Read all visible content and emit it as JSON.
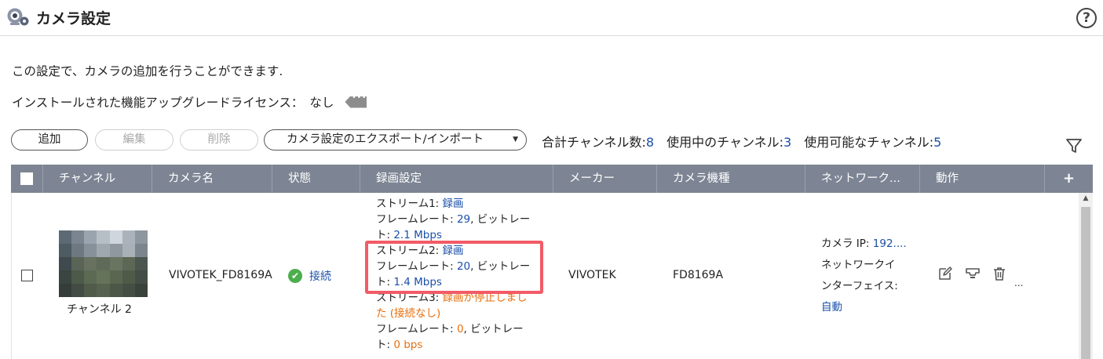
{
  "header": {
    "title": "カメラ設定",
    "help_glyph": "?",
    "app_icon": "camera-settings-icon"
  },
  "description": "この設定で、カメラの追加を行うことができます.",
  "license": {
    "label": "インストールされた機能アップグレードライセンス：",
    "value": "なし"
  },
  "toolbar": {
    "add_label": "追加",
    "edit_label": "編集",
    "delete_label": "削除",
    "export_import_label": "カメラ設定のエクスポート/インポート",
    "total_label": "合計チャンネル数:",
    "total_value": "8",
    "in_use_label": "使用中のチャンネル:",
    "in_use_value": "3",
    "available_label": "使用可能なチャンネル:",
    "available_value": "5"
  },
  "table": {
    "columns": [
      "チャンネル",
      "カメラ名",
      "状態",
      "録画設定",
      "メーカー",
      "カメラ機種",
      "ネットワーク...",
      "動作"
    ],
    "plus_glyph": "+",
    "rows": [
      {
        "channel_label": "チャンネル 2",
        "camera_name": "VIVOTEK_FD8169A",
        "status": "接続",
        "status_glyph": "✔",
        "recording": {
          "stream1_label": "ストリーム1: ",
          "stream1_value": "録画",
          "stream1_fr_label": "フレームレート: ",
          "stream1_fr_value": "29",
          "stream1_br_label": ", ビットレー",
          "stream1_br_wrap": "ト: ",
          "stream1_br_value": "2.1 Mbps",
          "stream2_label": "ストリーム2: ",
          "stream2_value": "録画",
          "stream2_fr_label": "フレームレート: ",
          "stream2_fr_value": "20",
          "stream2_br_label": ", ビットレー",
          "stream2_br_wrap": "ト: ",
          "stream2_br_value": "1.4 Mbps",
          "stream3_label": "ストリーム3: ",
          "stream3_value_line1": "録画が停止しまし",
          "stream3_value_line2": "た (接続なし)",
          "stream3_fr_label": "フレームレート: ",
          "stream3_fr_value": "0",
          "stream3_br_label": ", ビットレー",
          "stream3_br_wrap": "ト: ",
          "stream3_br_value": "0 bps"
        },
        "vendor": "VIVOTEK",
        "model": "FD8169A",
        "network": {
          "ip_label": "カメラ IP: ",
          "ip_value": "192....",
          "iface_label_line1": "ネットワークイ",
          "iface_label_line2": "ンターフェイス:",
          "iface_value": "自動"
        },
        "more_actions": "..."
      }
    ]
  },
  "colors": {
    "header_bg": "#7d8594",
    "link_blue": "#1a4fa8",
    "warning_orange": "#e8700f",
    "status_green": "#4cae4c",
    "highlight_red": "#f25b66"
  },
  "icons": [
    "camera-settings-icon",
    "help-icon",
    "more-tag-icon",
    "filter-icon",
    "connected-check-icon",
    "edit-icon",
    "monitor-icon",
    "trash-icon",
    "scroll-up-icon"
  ]
}
